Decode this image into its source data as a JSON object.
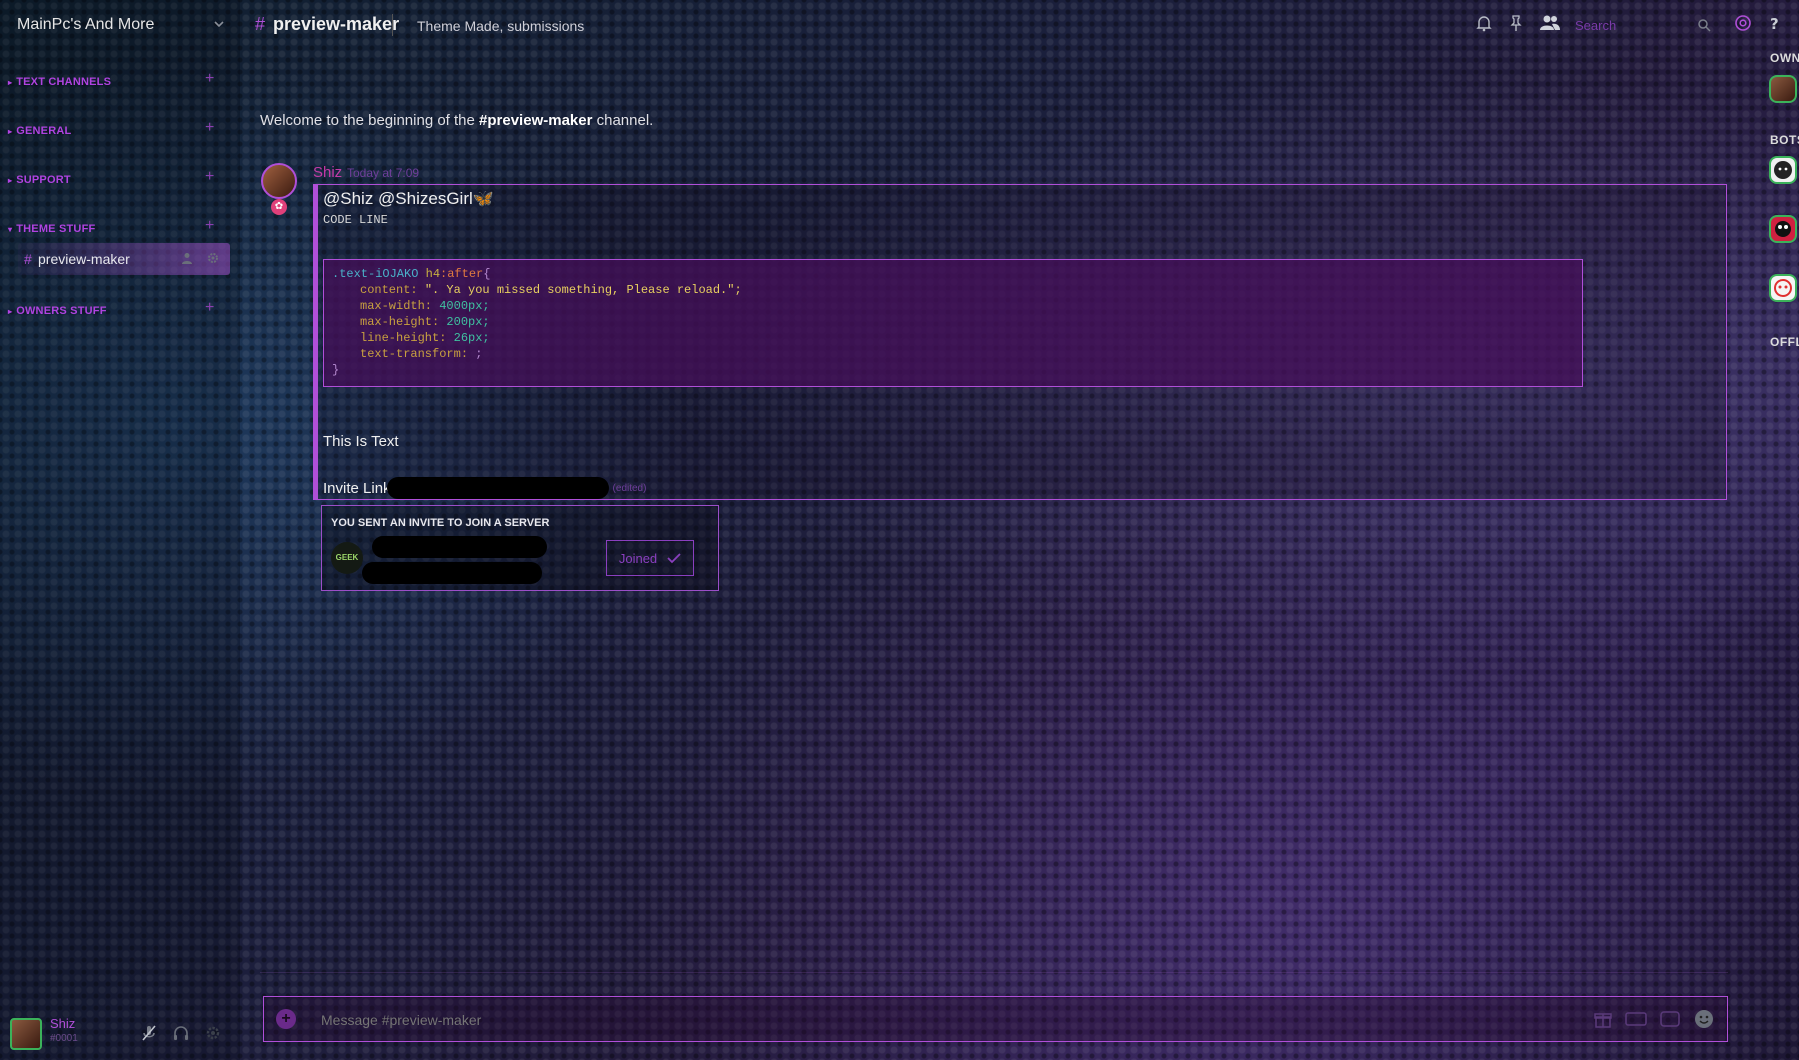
{
  "server": {
    "name": "MainPc's And More"
  },
  "categories": [
    {
      "label": "TEXT CHANNELS"
    },
    {
      "label": "GENERAL"
    },
    {
      "label": "SUPPORT"
    },
    {
      "label": "THEME STUFF"
    },
    {
      "label": "OWNERS STUFF"
    }
  ],
  "channel": {
    "name": "preview-maker",
    "hash": "#"
  },
  "user_panel": {
    "name": "Shiz",
    "tag": "#0001"
  },
  "topbar": {
    "hash": "#",
    "channel_name": "preview-maker",
    "topic": "Theme Made, submissions",
    "search_placeholder": "Search"
  },
  "members": {
    "categories": [
      "OWNER",
      "BOTS",
      "OFFLINE"
    ]
  },
  "welcome": {
    "prefix": "Welcome to the beginning of the ",
    "channel": "#preview-maker",
    "suffix": " channel."
  },
  "message": {
    "author": "Shiz",
    "timestamp": "Today at 7:09",
    "mention": "@Shiz @ShizesGirl",
    "mention_emoji": "🦋",
    "code_line": "CODE LINE",
    "code": {
      "l1_sel": ".text-iOJAKO",
      "l1_tag": "h4",
      "l1_pseudo": ":after",
      "l1_brace": "{",
      "l2_prop": "content:",
      "l2_val": "\". Ya you missed something, Please reload.\";",
      "l3_prop": "max-width:",
      "l3_val": "4000px;",
      "l4_prop": "max-height:",
      "l4_val": "200px;",
      "l5_prop": "line-height:",
      "l5_val": "26px;",
      "l6_prop": "text-transform:",
      "l6_val": ";",
      "l7_brace": "}"
    },
    "text": "This Is Text",
    "invite_label": "Invite Link",
    "edited": "(edited)"
  },
  "invite": {
    "title": "YOU SENT AN INVITE TO JOIN A SERVER",
    "icon_text": "GEEK",
    "button_label": "Joined"
  },
  "composer": {
    "placeholder": "Message #preview-maker"
  },
  "colors": {
    "accent": "#b04fd8",
    "author": "#c43aa8",
    "status_online": "#3bb25a"
  }
}
